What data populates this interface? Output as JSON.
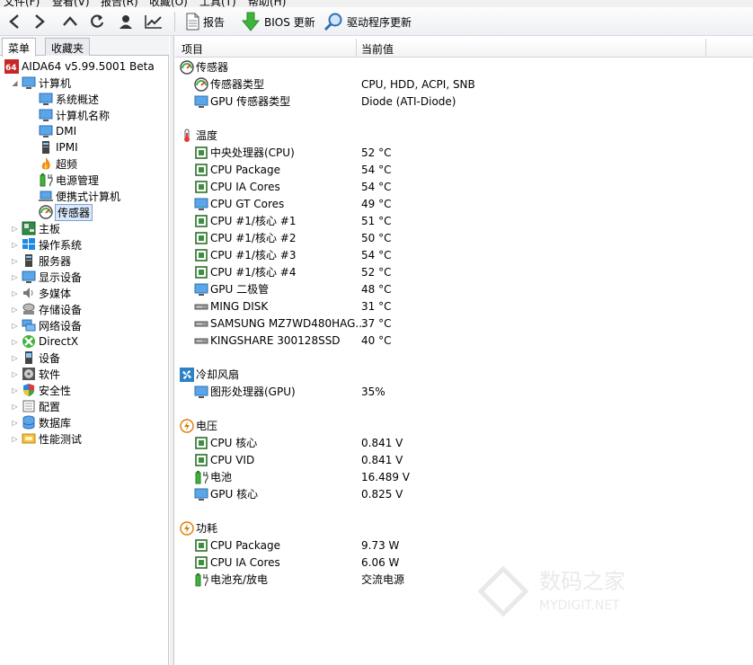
{
  "menubar": [
    "文件(F)",
    "查看(V)",
    "报告(R)",
    "收藏(O)",
    "工具(T)",
    "帮助(H)"
  ],
  "toolbar": {
    "report_label": "报告",
    "bios_label": "BIOS 更新",
    "driver_label": "驱动程序更新"
  },
  "tabs": {
    "menu": "菜单",
    "favorites": "收藏夹"
  },
  "tree": {
    "root": "AIDA64 v5.99.5001 Beta",
    "computer": "计算机",
    "computer_children": [
      "系统概述",
      "计算机名称",
      "DMI",
      "IPMI",
      "超频",
      "电源管理",
      "便携式计算机",
      "传感器"
    ],
    "others": [
      "主板",
      "操作系统",
      "服务器",
      "显示设备",
      "多媒体",
      "存储设备",
      "网络设备",
      "DirectX",
      "设备",
      "软件",
      "安全性",
      "配置",
      "数据库",
      "性能测试"
    ]
  },
  "columns": {
    "item": "项目",
    "value": "当前值"
  },
  "sections": [
    {
      "title": "传感器",
      "icon": "sensor-icon",
      "rows": [
        {
          "name": "传感器类型",
          "value": "CPU, HDD, ACPI, SNB",
          "icon": "sensor-icon"
        },
        {
          "name": "GPU 传感器类型",
          "value": "Diode  (ATI-Diode)",
          "icon": "monitor-icon"
        }
      ]
    },
    {
      "title": "温度",
      "icon": "thermometer-icon",
      "rows": [
        {
          "name": "中央处理器(CPU)",
          "value": "52 °C",
          "icon": "chip-icon"
        },
        {
          "name": "CPU Package",
          "value": "54 °C",
          "icon": "chip-icon"
        },
        {
          "name": "CPU IA Cores",
          "value": "54 °C",
          "icon": "chip-icon"
        },
        {
          "name": "CPU GT Cores",
          "value": "49 °C",
          "icon": "monitor-icon"
        },
        {
          "name": "CPU #1/核心 #1",
          "value": "51 °C",
          "icon": "chip-icon"
        },
        {
          "name": "CPU #1/核心 #2",
          "value": "50 °C",
          "icon": "chip-icon"
        },
        {
          "name": "CPU #1/核心 #3",
          "value": "54 °C",
          "icon": "chip-icon"
        },
        {
          "name": "CPU #1/核心 #4",
          "value": "52 °C",
          "icon": "chip-icon"
        },
        {
          "name": "GPU 二极管",
          "value": "48 °C",
          "icon": "monitor-icon"
        },
        {
          "name": "MING DISK",
          "value": "31 °C",
          "icon": "disk-icon"
        },
        {
          "name": "SAMSUNG MZ7WD480HAG...",
          "value": "37 °C",
          "icon": "disk-icon"
        },
        {
          "name": "KINGSHARE 300128SSD",
          "value": "40 °C",
          "icon": "disk-icon"
        }
      ]
    },
    {
      "title": "冷却风扇",
      "icon": "fan-icon",
      "rows": [
        {
          "name": "图形处理器(GPU)",
          "value": "35%",
          "icon": "monitor-icon"
        }
      ]
    },
    {
      "title": "电压",
      "icon": "voltage-icon",
      "rows": [
        {
          "name": "CPU 核心",
          "value": "0.841 V",
          "icon": "chip-icon"
        },
        {
          "name": "CPU VID",
          "value": "0.841 V",
          "icon": "chip-icon"
        },
        {
          "name": "电池",
          "value": "16.489 V",
          "icon": "battery-icon"
        },
        {
          "name": "GPU 核心",
          "value": "0.825 V",
          "icon": "monitor-icon"
        }
      ]
    },
    {
      "title": "功耗",
      "icon": "voltage-icon",
      "rows": [
        {
          "name": "CPU Package",
          "value": "9.73 W",
          "icon": "chip-icon"
        },
        {
          "name": "CPU IA Cores",
          "value": "6.06 W",
          "icon": "chip-icon"
        },
        {
          "name": "电池充/放电",
          "value": "交流电源",
          "icon": "battery-icon"
        }
      ]
    }
  ],
  "watermark": {
    "line1": "数码之家",
    "line2": "MYDIGIT.NET"
  }
}
